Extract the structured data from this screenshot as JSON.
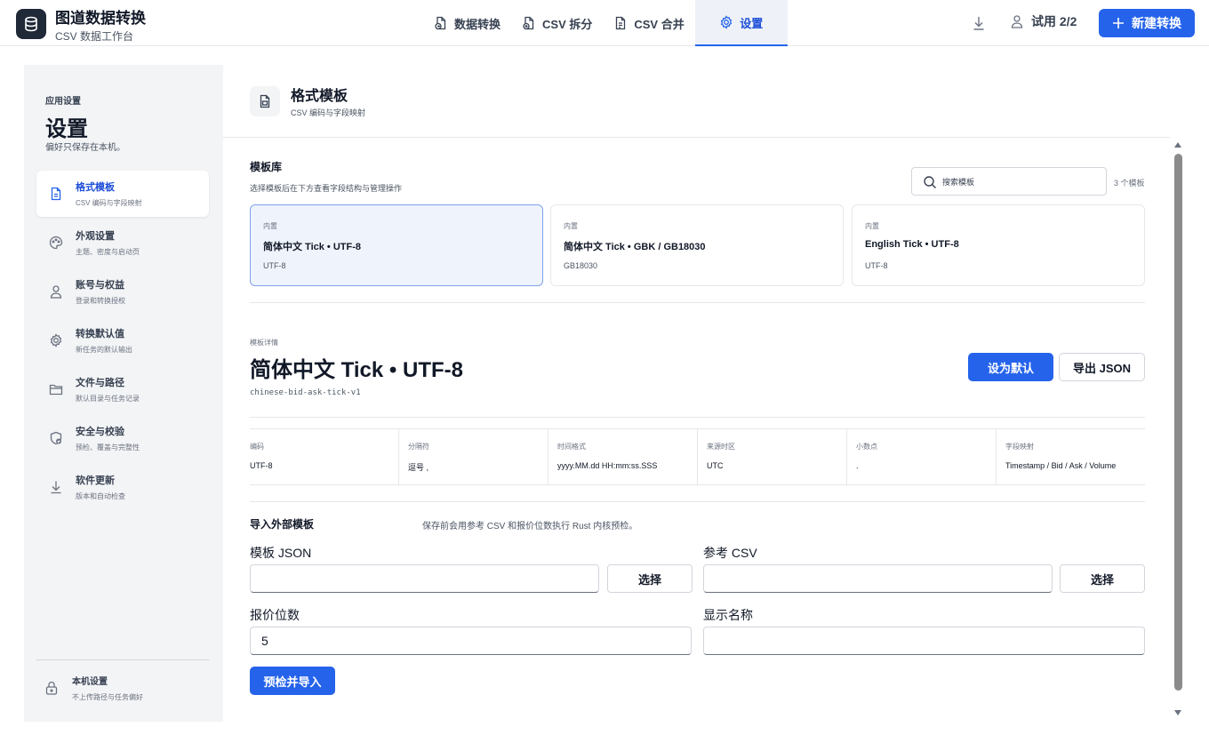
{
  "app": {
    "title": "图道数据转换",
    "subtitle": "CSV 数据工作台",
    "logo_icon": "database-icon"
  },
  "nav": {
    "tabs": [
      {
        "label": "数据转换",
        "icon": "file-convert-icon",
        "active": false
      },
      {
        "label": "CSV 拆分",
        "icon": "file-split-icon",
        "active": false
      },
      {
        "label": "CSV 合并",
        "icon": "file-merge-icon",
        "active": false
      },
      {
        "label": "设置",
        "icon": "gear-icon",
        "active": true
      }
    ]
  },
  "header": {
    "trial_label": "试用 2/2",
    "new_button_label": "新建转换"
  },
  "sidebar": {
    "overline": "应用设置",
    "title": "设置",
    "description": "偏好只保存在本机。",
    "items": [
      {
        "label": "格式模板",
        "sub": "CSV 编码与字段映射",
        "icon": "file-template-icon",
        "active": true
      },
      {
        "label": "外观设置",
        "sub": "主题、密度与启动页",
        "icon": "palette-icon",
        "active": false
      },
      {
        "label": "账号与权益",
        "sub": "登录和转换授权",
        "icon": "user-icon",
        "active": false
      },
      {
        "label": "转换默认值",
        "sub": "新任务的默认输出",
        "icon": "gear-icon",
        "active": false
      },
      {
        "label": "文件与路径",
        "sub": "默认目录与任务记录",
        "icon": "folder-icon",
        "active": false
      },
      {
        "label": "安全与校验",
        "sub": "预检、覆盖与完整性",
        "icon": "shield-check-icon",
        "active": false
      },
      {
        "label": "软件更新",
        "sub": "版本和自动检查",
        "icon": "download-icon",
        "active": false
      }
    ],
    "footer": {
      "title": "本机设置",
      "sub": "不上传路径与任务偏好",
      "icon": "lock-icon"
    }
  },
  "main": {
    "title": "格式模板",
    "subtitle": "CSV 编码与字段映射",
    "library": {
      "title": "模板库",
      "subtitle": "选择模板后在下方查看字段结构与管理操作",
      "search_placeholder": "搜索模板",
      "count": "3 个模板",
      "cards": [
        {
          "tag": "内置",
          "name": "简体中文 Tick • UTF-8",
          "encoding": "UTF-8",
          "selected": true
        },
        {
          "tag": "内置",
          "name": "简体中文 Tick • GBK / GB18030",
          "encoding": "GB18030",
          "selected": false
        },
        {
          "tag": "内置",
          "name": "English Tick • UTF-8",
          "encoding": "UTF-8",
          "selected": false
        }
      ]
    },
    "detail": {
      "overline": "模板详情",
      "title": "简体中文 Tick • UTF-8",
      "id": "chinese-bid-ask-tick-v1",
      "default_button": "设为默认",
      "export_button": "导出 JSON",
      "props": [
        {
          "label": "编码",
          "value": "UTF-8"
        },
        {
          "label": "分隔符",
          "value": "逗号 ,"
        },
        {
          "label": "时间格式",
          "value": "yyyy.MM.dd HH:mm:ss.SSS"
        },
        {
          "label": "来源时区",
          "value": "UTC"
        },
        {
          "label": "小数点",
          "value": "."
        },
        {
          "label": "字段映射",
          "value": "Timestamp / Bid / Ask / Volume"
        }
      ]
    },
    "import": {
      "title": "导入外部模板",
      "hint": "保存前会用参考 CSV 和报价位数执行 Rust 内核预检。",
      "json_label": "模板 JSON",
      "json_value": "",
      "csv_label": "参考 CSV",
      "csv_value": "",
      "choose_label": "选择",
      "digits_label": "报价位数",
      "digits_value": "5",
      "name_label": "显示名称",
      "name_value": "",
      "submit_label": "预检并导入"
    }
  },
  "colors": {
    "accent": "#2563eb",
    "sidebar_bg": "#f3f4f6",
    "selected_card_bg": "#eff4fc"
  }
}
